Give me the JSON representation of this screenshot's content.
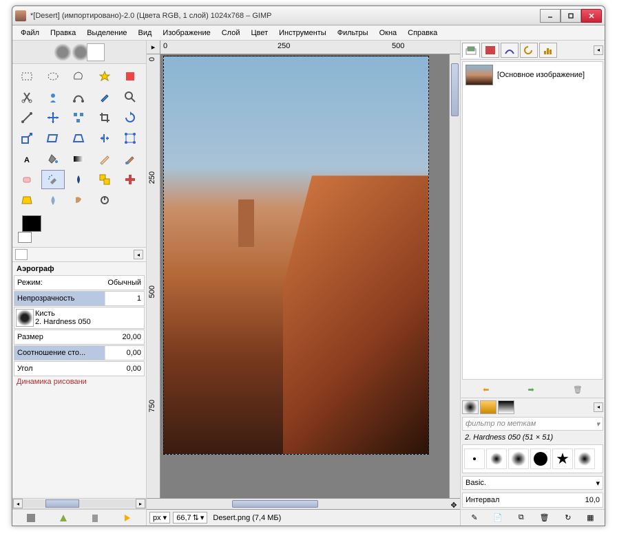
{
  "title": "*[Desert] (импортировано)-2.0 (Цвета RGB, 1 слой) 1024x768 – GIMP",
  "menu": [
    "Файл",
    "Правка",
    "Выделение",
    "Вид",
    "Изображение",
    "Слой",
    "Цвет",
    "Инструменты",
    "Фильтры",
    "Окна",
    "Справка"
  ],
  "ruler_h": {
    "t0": "0",
    "t1": "250",
    "t2": "500"
  },
  "ruler_v": {
    "t0": "0",
    "t1": "250",
    "t2": "500",
    "t3": "750"
  },
  "status": {
    "unit": "px",
    "zoom": "66,7",
    "file": "Desert.png (7,4 МБ)"
  },
  "tool_opts": {
    "title": "Аэрограф",
    "mode_label": "Режим:",
    "mode_value": "Обычный",
    "opacity_label": "Непрозрачность",
    "opacity_value": "1",
    "brush_label": "Кисть",
    "brush_name": "2. Hardness 050",
    "size_label": "Размер",
    "size_value": "20,00",
    "ratio_label": "Соотношение сто...",
    "ratio_value": "0,00",
    "angle_label": "Угол",
    "angle_value": "0,00",
    "dynamics": "Динамика рисовани"
  },
  "layers": {
    "item": "[Основное изображение]"
  },
  "brushes": {
    "filter_placeholder": "фильтр по меткам",
    "current": "2. Hardness 050 (51 × 51)",
    "preset": "Basic.",
    "interval_label": "Интервал",
    "interval_value": "10,0"
  },
  "tools": [
    "rect-select",
    "ellipse-select",
    "free-select",
    "fuzzy-select",
    "color-select",
    "scissors",
    "foreground-select",
    "paths",
    "color-picker",
    "zoom",
    "measure",
    "move",
    "align",
    "crop",
    "rotate",
    "scale",
    "shear",
    "perspective",
    "flip",
    "cage",
    "text",
    "bucket-fill",
    "blend",
    "pencil",
    "paintbrush",
    "eraser",
    "airbrush",
    "ink",
    "clone",
    "heal",
    "perspective-clone",
    "blur",
    "smudge",
    "dodge",
    ""
  ]
}
